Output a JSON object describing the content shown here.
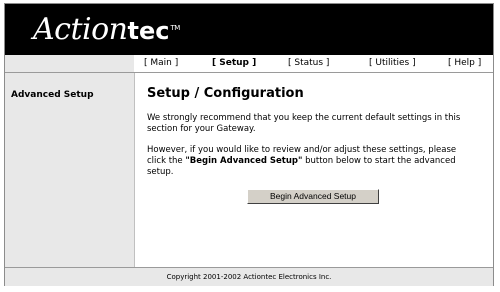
{
  "brand": {
    "logo_main": "Action",
    "logo_tail": "tec",
    "trademark": "TM"
  },
  "nav": {
    "items": [
      {
        "label": "[ Main ]"
      },
      {
        "label": "[ Setup ]"
      },
      {
        "label": "[ Status ]"
      },
      {
        "label": "[ Utilities ]"
      },
      {
        "label": "[ Help ]"
      }
    ],
    "active": "Setup"
  },
  "sidebar": {
    "items": [
      {
        "label": "Advanced Setup"
      }
    ]
  },
  "main": {
    "title": "Setup / Configuration",
    "para1": "We strongly recommend that you keep the current default settings in this section for your Gateway.",
    "para2_before": "However, if you would like to review and/or adjust these settings, please click the ",
    "para2_bold": "\"Begin Advanced Setup\"",
    "para2_after": " button below to start the advanced setup.",
    "button_label": "Begin Advanced Setup"
  },
  "footer": {
    "copyright": "Copyright 2001-2002 Actiontec Electronics Inc."
  },
  "colors": {
    "header_bg": "#000000",
    "sidebar_bg": "#e8e8e8",
    "button_bg": "#d4d0c8"
  }
}
